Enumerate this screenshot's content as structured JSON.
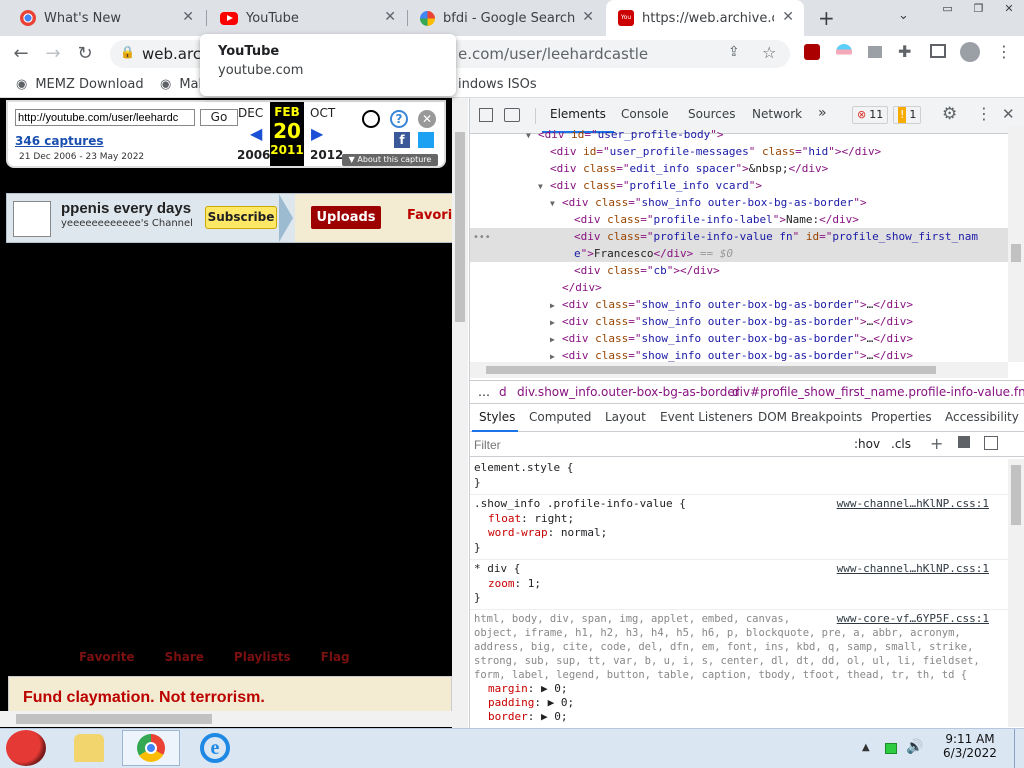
{
  "tabs": [
    {
      "title": "What's New",
      "icon": "chrome-icon"
    },
    {
      "title": "YouTube",
      "icon": "youtube-icon"
    },
    {
      "title": "bfdi - Google Search",
      "icon": "google-icon"
    },
    {
      "title": "https://web.archive.org",
      "icon": "youtube-icon"
    }
  ],
  "new_tab_label": "+",
  "address": {
    "prefix": "web.arch",
    "suffix": "e.com/user/leehardcastle"
  },
  "bookmarks": [
    "MEMZ Download",
    "Mal",
    "indows ISOs"
  ],
  "tooltip": {
    "title": "YouTube",
    "subtitle": "youtube.com"
  },
  "wayback": {
    "url_value": "http://youtube.com/user/leehardc",
    "go": "Go",
    "captures": "346 captures",
    "range": "21 Dec 2006 - 23 May 2022",
    "months": [
      "DEC",
      "FEB",
      "OCT"
    ],
    "day": "20",
    "years": [
      "2006",
      "2011",
      "2012"
    ],
    "about": "About this capture"
  },
  "channel": {
    "name": "ppenis every days",
    "sub": "yeeeeeeeeeeee's Channel",
    "subscribe": "Subscribe",
    "uploads": "Uploads",
    "favorites": "Favorit"
  },
  "player_links": [
    "Favorite",
    "Share",
    "Playlists",
    "Flag"
  ],
  "banner": "Fund claymation. Not terrorism.",
  "devtools": {
    "tabs": [
      "Elements",
      "Console",
      "Sources",
      "Network"
    ],
    "errors": "11",
    "warnings": "1",
    "dom": [
      {
        "indent": 6,
        "arrow": "▼",
        "parts": [
          [
            "tag",
            "<div "
          ],
          [
            "an",
            "id"
          ],
          [
            "tag",
            "=\""
          ],
          [
            "av",
            "user_profile-body"
          ],
          [
            "tag",
            "\">"
          ]
        ]
      },
      {
        "indent": 7,
        "arrow": "",
        "parts": [
          [
            "tag",
            "<div "
          ],
          [
            "an",
            "id"
          ],
          [
            "tag",
            "=\""
          ],
          [
            "av",
            "user_profile-messages"
          ],
          [
            "tag",
            "\" "
          ],
          [
            "an",
            "class"
          ],
          [
            "tag",
            "=\""
          ],
          [
            "av",
            "hid"
          ],
          [
            "tag",
            "\"></div>"
          ]
        ]
      },
      {
        "indent": 7,
        "arrow": "",
        "parts": [
          [
            "tag",
            "<div "
          ],
          [
            "an",
            "class"
          ],
          [
            "tag",
            "=\""
          ],
          [
            "av",
            "edit_info spacer"
          ],
          [
            "tag",
            "\">"
          ],
          [
            "tx",
            "&nbsp;"
          ],
          [
            "tag",
            "</div>"
          ]
        ]
      },
      {
        "indent": 7,
        "arrow": "▼",
        "parts": [
          [
            "tag",
            "<div "
          ],
          [
            "an",
            "class"
          ],
          [
            "tag",
            "=\""
          ],
          [
            "av",
            "profile_info vcard"
          ],
          [
            "tag",
            "\">"
          ]
        ]
      },
      {
        "indent": 8,
        "arrow": "▼",
        "parts": [
          [
            "tag",
            "<div "
          ],
          [
            "an",
            "class"
          ],
          [
            "tag",
            "=\""
          ],
          [
            "av",
            "show_info outer-box-bg-as-border"
          ],
          [
            "tag",
            "\">"
          ]
        ]
      },
      {
        "indent": 9,
        "arrow": "",
        "parts": [
          [
            "tag",
            "<div "
          ],
          [
            "an",
            "class"
          ],
          [
            "tag",
            "=\""
          ],
          [
            "av",
            "profile-info-label"
          ],
          [
            "tag",
            "\">"
          ],
          [
            "tx",
            "Name:"
          ],
          [
            "tag",
            "</div>"
          ]
        ]
      },
      {
        "indent": 9,
        "arrow": "",
        "sel": true,
        "parts": [
          [
            "tag",
            "<div "
          ],
          [
            "an",
            "class"
          ],
          [
            "tag",
            "=\""
          ],
          [
            "av",
            "profile-info-value fn"
          ],
          [
            "tag",
            "\" "
          ],
          [
            "an",
            "id"
          ],
          [
            "tag",
            "=\""
          ],
          [
            "av",
            "profile_show_first_nam"
          ]
        ]
      },
      {
        "indent": 9,
        "arrow": "",
        "sel": true,
        "parts": [
          [
            "av",
            "e"
          ],
          [
            "tag",
            "\">"
          ],
          [
            "tx",
            "Francesco"
          ],
          [
            "tag",
            "</div>"
          ],
          [
            "an",
            " == $0"
          ]
        ]
      },
      {
        "indent": 9,
        "arrow": "",
        "parts": [
          [
            "tag",
            "<div "
          ],
          [
            "an",
            "class"
          ],
          [
            "tag",
            "=\""
          ],
          [
            "av",
            "cb"
          ],
          [
            "tag",
            "\"></div>"
          ]
        ]
      },
      {
        "indent": 8,
        "arrow": "",
        "parts": [
          [
            "tag",
            "</div>"
          ]
        ]
      },
      {
        "indent": 8,
        "arrow": "▶",
        "parts": [
          [
            "tag",
            "<div "
          ],
          [
            "an",
            "class"
          ],
          [
            "tag",
            "=\""
          ],
          [
            "av",
            "show_info outer-box-bg-as-border"
          ],
          [
            "tag",
            "\">"
          ],
          [
            "tx",
            "…"
          ],
          [
            "tag",
            "</div>"
          ]
        ]
      },
      {
        "indent": 8,
        "arrow": "▶",
        "parts": [
          [
            "tag",
            "<div "
          ],
          [
            "an",
            "class"
          ],
          [
            "tag",
            "=\""
          ],
          [
            "av",
            "show_info outer-box-bg-as-border"
          ],
          [
            "tag",
            "\">"
          ],
          [
            "tx",
            "…"
          ],
          [
            "tag",
            "</div>"
          ]
        ]
      },
      {
        "indent": 8,
        "arrow": "▶",
        "parts": [
          [
            "tag",
            "<div "
          ],
          [
            "an",
            "class"
          ],
          [
            "tag",
            "=\""
          ],
          [
            "av",
            "show_info outer-box-bg-as-border"
          ],
          [
            "tag",
            "\">"
          ],
          [
            "tx",
            "…"
          ],
          [
            "tag",
            "</div>"
          ]
        ]
      },
      {
        "indent": 8,
        "arrow": "▶",
        "parts": [
          [
            "tag",
            "<div "
          ],
          [
            "an",
            "class"
          ],
          [
            "tag",
            "=\""
          ],
          [
            "av",
            "show_info outer-box-bg-as-border"
          ],
          [
            "tag",
            "\">"
          ],
          [
            "tx",
            "…"
          ],
          [
            "tag",
            "</div>"
          ]
        ]
      }
    ],
    "crumbs": [
      "…",
      "d",
      "div.show_info.outer-box-bg-as-border",
      "div#profile_show_first_name.profile-info-value.fn"
    ],
    "style_tabs": [
      "Styles",
      "Computed",
      "Layout",
      "Event Listeners",
      "DOM Breakpoints",
      "Properties",
      "Accessibility"
    ],
    "filter": "Filter",
    "hov": ":hov",
    "cls": ".cls",
    "element_style": "element.style {",
    "close_brace": "}",
    "rule1": {
      "selector": ".show_info .profile-info-value {",
      "source": "www-channel…hKlNP.css:1",
      "props": [
        [
          "float",
          "right;"
        ],
        [
          "word-wrap",
          "normal;"
        ]
      ]
    },
    "rule2": {
      "selector": "* div {",
      "source": "www-channel…hKlNP.css:1",
      "props": [
        [
          "zoom",
          "1;"
        ]
      ]
    },
    "rule3": {
      "source": "www-core-vf…6YP5F.css:1",
      "selector_lines": [
        "html, body, div, span, img, applet, embed, canvas,",
        "object, iframe, h1, h2, h3, h4, h5, h6, p, blockquote, pre, a, abbr, acronym,",
        "address, big, cite, code, del, dfn, em, font, ins, kbd, q, samp, small, strike,",
        "strong, sub, sup, tt, var, b, u, i, s, center, dl, dt, dd, ol, ul, li, fieldset,",
        "form, label, legend, button, table, caption, tbody, tfoot, thead, tr, th, td {"
      ],
      "props": [
        [
          "margin",
          "▶ 0;"
        ],
        [
          "padding",
          "▶ 0;"
        ],
        [
          "border",
          "▶ 0;"
        ]
      ]
    }
  },
  "clock": {
    "time": "9:11 AM",
    "date": "6/3/2022"
  }
}
